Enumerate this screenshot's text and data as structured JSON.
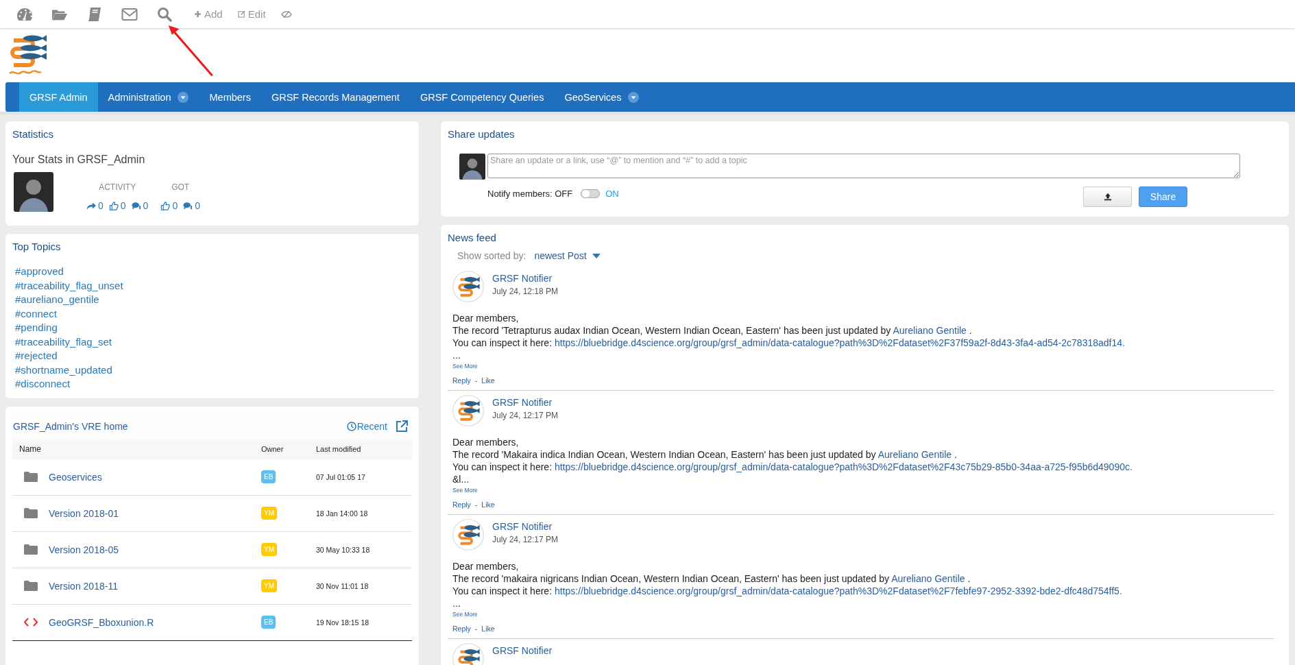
{
  "toolbar": {
    "icons": [
      {
        "kind": "dashboard"
      },
      {
        "kind": "folder"
      },
      {
        "kind": "book"
      },
      {
        "kind": "mail"
      },
      {
        "kind": "search"
      }
    ],
    "actions": [
      {
        "kind": "add",
        "label": "Add"
      },
      {
        "kind": "edit",
        "label": "Edit"
      },
      {
        "kind": "hide"
      }
    ]
  },
  "nav": [
    {
      "label": "GRSF Admin",
      "selected": true,
      "dropdown": false
    },
    {
      "label": "Administration",
      "selected": false,
      "dropdown": true
    },
    {
      "label": "Members",
      "selected": false,
      "dropdown": false
    },
    {
      "label": "GRSF Records Management",
      "selected": false,
      "dropdown": false
    },
    {
      "label": "GRSF Competency Queries",
      "selected": false,
      "dropdown": false
    },
    {
      "label": "GeoServices",
      "selected": false,
      "dropdown": true
    }
  ],
  "statistics": {
    "title": "Statistics",
    "subtitle": "Your Stats in GRSF_Admin",
    "activity_label": "ACTIVITY",
    "got_label": "GOT",
    "activity": [
      {
        "kind": "share",
        "count": "0"
      },
      {
        "kind": "like",
        "count": "0"
      },
      {
        "kind": "comment",
        "count": "0"
      }
    ],
    "got": [
      {
        "kind": "like",
        "count": "0"
      },
      {
        "kind": "comment",
        "count": "0"
      }
    ]
  },
  "top_topics": {
    "title": "Top Topics",
    "topics": [
      "#approved",
      "#traceability_flag_unset",
      "#aureliano_gentile",
      "#connect",
      "#pending",
      "#traceability_flag_set",
      "#rejected",
      "#shortname_updated",
      "#disconnect"
    ]
  },
  "vre_home": {
    "title": "GRSF_Admin's VRE home",
    "recent": "Recent",
    "columns": [
      "Name",
      "Owner",
      "Last modified"
    ],
    "rows": [
      {
        "kind": "folder",
        "name": "Geoservices",
        "owner": "EB",
        "color": "#5bc0f0",
        "modified": "07 Jul 01:05 17"
      },
      {
        "kind": "folder",
        "name": "Version 2018-01",
        "owner": "YM",
        "color": "#ffcc00",
        "modified": "18 Jan 14:00 18"
      },
      {
        "kind": "folder",
        "name": "Version 2018-05",
        "owner": "YM",
        "color": "#ffcc00",
        "modified": "30 May 10:33 18"
      },
      {
        "kind": "folder",
        "name": "Version 2018-11",
        "owner": "YM",
        "color": "#ffcc00",
        "modified": "30 Nov 11:01 18"
      },
      {
        "kind": "code",
        "name": "GeoGRSF_Bboxunion.R",
        "owner": "EB",
        "color": "#5bc0f0",
        "modified": "19 Nov 18:15 18"
      }
    ]
  },
  "share": {
    "title": "Share updates",
    "placeholder": "Share an update or a link, use “@” to mention and “#” to add a topic",
    "notify_label": "Notify members: OFF",
    "notify_on_label": "ON",
    "notify_on": false,
    "share_button": "Share"
  },
  "news_feed": {
    "title": "News feed",
    "sort_label": "Show sorted by:",
    "sort_value": "newest Post",
    "posts": [
      {
        "author": "GRSF Notifier",
        "time": "July 24, 12:18 PM",
        "greeting": "Dear members,",
        "record": "The record 'Tetrapturus audax Indian Ocean, Western Indian Ocean, Eastern' has been just updated by",
        "user": "Aureliano Gentile",
        "end": ".",
        "inspect": "You can inspect it here:",
        "url": "https://bluebridge.d4science.org/group/grsf_admin/data-catalogue?path%3D%2Fdataset%2F37f59a2f-8d43-3fa4-ad54-2c78318adf14.",
        "tail": "...",
        "see_more": "See More",
        "reply": "Reply",
        "sep": "-",
        "like": "Like"
      },
      {
        "author": "GRSF Notifier",
        "time": "July 24, 12:17 PM",
        "greeting": "Dear members,",
        "record": "The record 'Makaira indica Indian Ocean, Western Indian Ocean, Eastern' has been just updated by",
        "user": "Aureliano Gentile",
        "end": ".",
        "inspect": "You can inspect it here:",
        "url": "https://bluebridge.d4science.org/group/grsf_admin/data-catalogue?path%3D%2Fdataset%2F43c75b29-85b0-34aa-a725-f95b6d49090c.",
        "tail": "&l...",
        "see_more": "See More",
        "reply": "Reply",
        "sep": "-",
        "like": "Like"
      },
      {
        "author": "GRSF Notifier",
        "time": "July 24, 12:17 PM",
        "greeting": "Dear members,",
        "record": "The record 'makaira nigricans Indian Ocean, Western Indian Ocean, Eastern' has been just updated by",
        "user": "Aureliano Gentile",
        "end": ".",
        "inspect": "You can inspect it here:",
        "url": "https://bluebridge.d4science.org/group/grsf_admin/data-catalogue?path%3D%2Fdataset%2F7febfe97-2952-3392-bde2-dfc48d754ff5.",
        "tail": "...",
        "see_more": "See More",
        "reply": "Reply",
        "sep": "-",
        "like": "Like"
      },
      {
        "author": "GRSF Notifier"
      }
    ]
  }
}
